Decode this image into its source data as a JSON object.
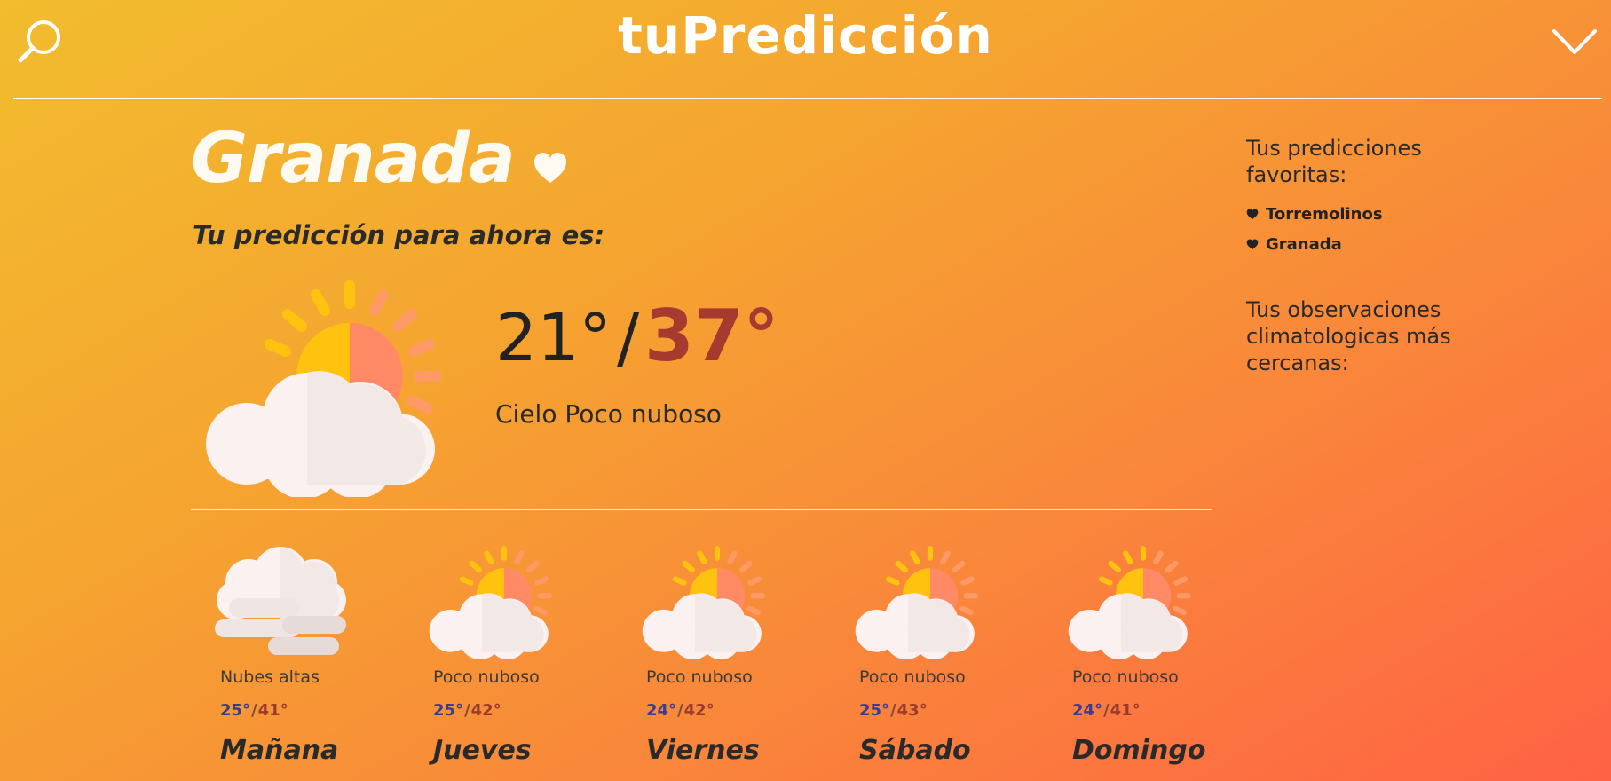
{
  "header": {
    "brand": "tuPredicción",
    "search_icon": "search-icon",
    "menu_icon": "chevron-down-icon"
  },
  "location": {
    "city": "Granada",
    "favorite_icon": "heart-icon"
  },
  "now": {
    "subtitle": "Tu predicción para ahora es:",
    "temp_min": "21°",
    "separator": "/",
    "temp_max": "37°",
    "description": "Cielo Poco nuboso",
    "icon": "partly-cloudy-icon"
  },
  "forecast": [
    {
      "day": "Mañana",
      "description": "Nubes altas",
      "min": "25°",
      "max": "41°",
      "icon": "high-clouds-icon"
    },
    {
      "day": "Jueves",
      "description": "Poco nuboso",
      "min": "25°",
      "max": "42°",
      "icon": "partly-cloudy-icon"
    },
    {
      "day": "Viernes",
      "description": "Poco nuboso",
      "min": "24°",
      "max": "42°",
      "icon": "partly-cloudy-icon"
    },
    {
      "day": "Sábado",
      "description": "Poco nuboso",
      "min": "25°",
      "max": "43°",
      "icon": "partly-cloudy-icon"
    },
    {
      "day": "Domingo",
      "description": "Poco nuboso",
      "min": "24°",
      "max": "41°",
      "icon": "partly-cloudy-icon"
    }
  ],
  "sidebar": {
    "favorites_title": "Tus predicciones favoritas:",
    "favorites": [
      "Torremolinos",
      "Granada"
    ],
    "observations_title": "Tus observaciones climatologicas más cercanas:"
  },
  "colors": {
    "background_start": "#f2bc2e",
    "background_end": "#ff6244",
    "temp_max": "#a63a2e",
    "temp_min_small": "#3b3c8c"
  }
}
